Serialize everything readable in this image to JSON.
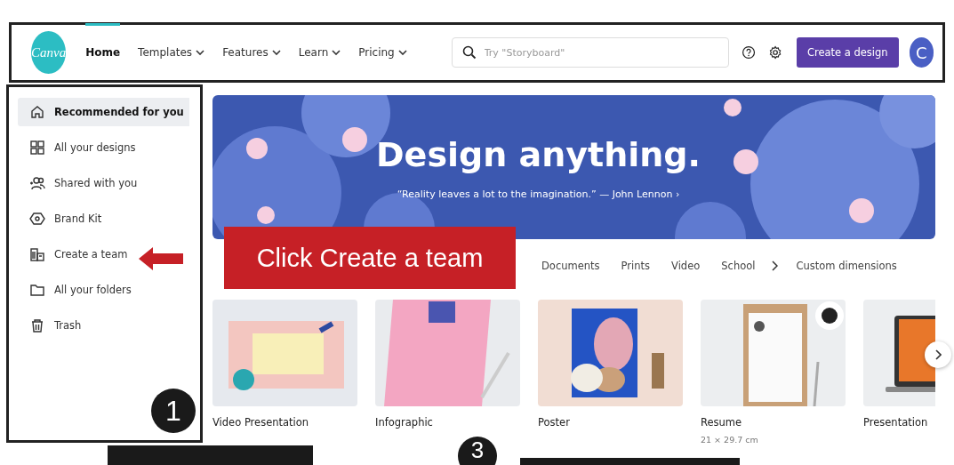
{
  "nav": {
    "logo": "Canva",
    "items": [
      {
        "label": "Home",
        "selected": true,
        "dropdown": false
      },
      {
        "label": "Templates",
        "selected": false,
        "dropdown": true
      },
      {
        "label": "Features",
        "selected": false,
        "dropdown": true
      },
      {
        "label": "Learn",
        "selected": false,
        "dropdown": true
      },
      {
        "label": "Pricing",
        "selected": false,
        "dropdown": true
      }
    ]
  },
  "search": {
    "placeholder": "Try \"Storyboard\""
  },
  "create_button": "Create a design",
  "avatar": "C",
  "sidebar": {
    "items": [
      {
        "label": "Recommended for you",
        "kind": "home",
        "selected": true
      },
      {
        "label": "All your designs",
        "kind": "grid",
        "selected": false
      },
      {
        "label": "Shared with you",
        "kind": "people",
        "selected": false
      },
      {
        "label": "Brand Kit",
        "kind": "brand",
        "selected": false
      },
      {
        "label": "Create a team",
        "kind": "team",
        "selected": false
      },
      {
        "label": "All your folders",
        "kind": "folder",
        "selected": false
      },
      {
        "label": "Trash",
        "kind": "trash",
        "selected": false
      }
    ]
  },
  "banner": {
    "title": "Design anything.",
    "quote": "“Reality leaves a lot to the imagination.” — John Lennon ›"
  },
  "category_tabs": [
    {
      "label": "Documents"
    },
    {
      "label": "Prints"
    },
    {
      "label": "Video"
    },
    {
      "label": "School"
    },
    {
      "label": "Custom dimensions"
    }
  ],
  "designs": [
    {
      "title": "Video Presentation",
      "kind": "slide"
    },
    {
      "title": "Infographic",
      "kind": "pink"
    },
    {
      "title": "Poster",
      "kind": "poster"
    },
    {
      "title": "Resume",
      "kind": "resume",
      "size": "21 × 29.7 cm"
    },
    {
      "title": "Presentation",
      "kind": "laptop"
    }
  ],
  "annotations": {
    "callout": "Click Create a team",
    "step_markers": [
      "1",
      "3"
    ]
  }
}
